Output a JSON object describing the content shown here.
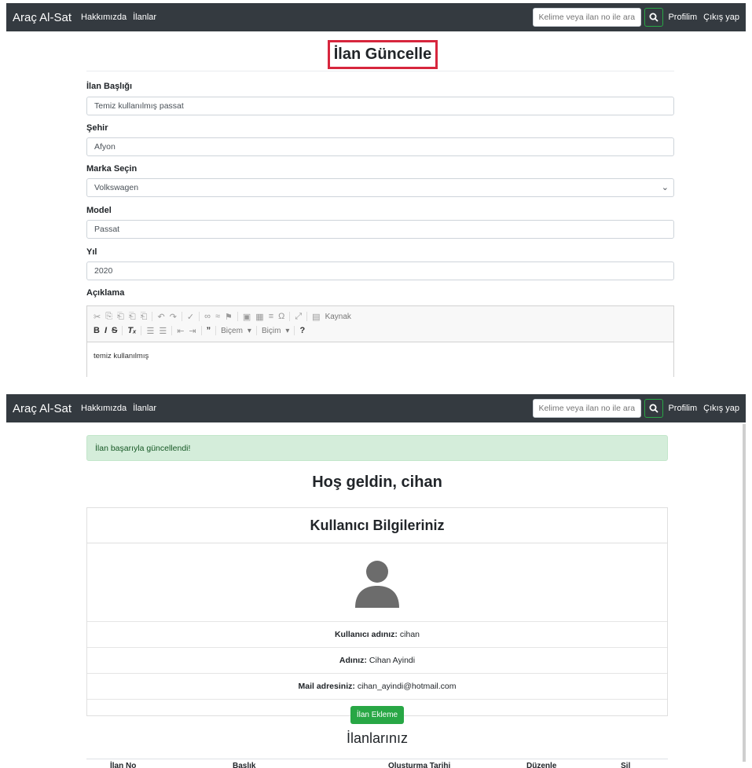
{
  "nav": {
    "brand": "Araç Al-Sat",
    "links": [
      "Hakkımızda",
      "İlanlar"
    ],
    "search_placeholder": "Kelime veya ilan no ile ara",
    "profile": "Profilim",
    "logout": "Çıkış yap"
  },
  "form": {
    "title": "İlan Güncelle",
    "fields": [
      {
        "label": "İlan Başlığı",
        "value": "Temiz kullanılmış passat"
      },
      {
        "label": "Şehir",
        "value": "Afyon"
      },
      {
        "label": "Marka Seçin",
        "value": "Volkswagen"
      },
      {
        "label": "Model",
        "value": "Passat"
      },
      {
        "label": "Yıl",
        "value": "2020"
      }
    ],
    "description_label": "Açıklama",
    "editor": {
      "source_label": "Kaynak",
      "format1": "Biçem",
      "format2": "Biçim",
      "help": "?",
      "content": "temiz kullanılmış"
    }
  },
  "dashboard": {
    "alert": "İlan başarıyla güncellendi!",
    "welcome": "Hoş geldin, cihan",
    "card_title": "Kullanıcı Bilgileriniz",
    "username_label": "Kullanıcı adınız:",
    "username": "cihan",
    "name_label": "Adınız:",
    "name": "Cihan Ayindi",
    "email_label": "Mail adresiniz:",
    "email": "cihan_ayindi@hotmail.com",
    "add_button": "İlan Ekleme",
    "listings_title": "İlanlarınız",
    "columns": [
      "İlan No",
      "Başlık",
      "Oluşturma Tarihi",
      "Düzenle",
      "Sil"
    ]
  },
  "colors": {
    "navbar": "#343a40",
    "success": "#28a745",
    "highlight": "#d7263d",
    "alert_bg": "#d4edda"
  },
  "icons": [
    "search-icon",
    "user-avatar-icon",
    "chevron-down-icon"
  ]
}
